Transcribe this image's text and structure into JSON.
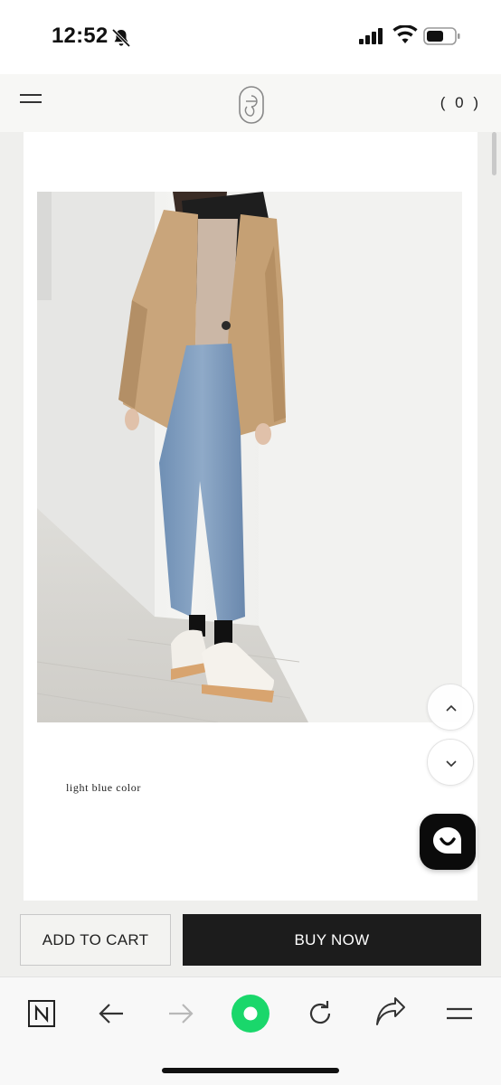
{
  "status_bar": {
    "time": "12:52",
    "icons": [
      "bell-slash-icon",
      "cellular-signal-icon",
      "wifi-icon",
      "battery-icon"
    ]
  },
  "header": {
    "menu_icon": "hamburger-menu-icon",
    "logo_icon": "brand-logo",
    "cart_count": "( 0 )"
  },
  "product": {
    "caption": "light blue color",
    "image_alt": "model wearing beige blazer, black hoodie and light blue jeans"
  },
  "floating": {
    "scroll_up_icon": "chevron-up-icon",
    "scroll_down_icon": "chevron-down-icon",
    "chat_icon": "chat-bubble-icon"
  },
  "purchase": {
    "add_to_cart": "ADD TO CART",
    "buy_now": "BUY NOW"
  },
  "browser_toolbar": {
    "items": [
      "naver-n-icon",
      "back-arrow-icon",
      "forward-arrow-icon",
      "green-home-icon",
      "reload-icon",
      "share-icon",
      "menu-icon"
    ]
  },
  "colors": {
    "accent_green": "#1ad76b",
    "buy_now_bg": "#1c1c1c",
    "page_bg": "#efefed"
  }
}
